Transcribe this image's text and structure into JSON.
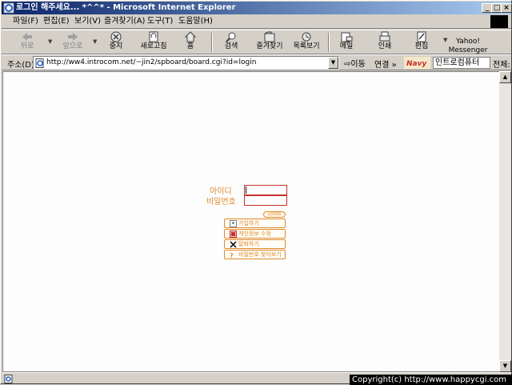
{
  "window": {
    "title": "로그인 해주세요... *^^* - Microsoft Internet Explorer",
    "minimize": "_",
    "maximize": "□",
    "close": "×"
  },
  "menu": [
    "파일(F)",
    "편집(E)",
    "보기(V)",
    "즐겨찾기(A)",
    "도구(T)",
    "도움말(H)"
  ],
  "toolbar": {
    "back": "뒤로",
    "forward": "앞으로",
    "stop": "중지",
    "refresh": "새로고침",
    "home": "홈",
    "search": "검색",
    "favorites": "즐겨찾기",
    "history": "목록보기",
    "mail": "메일",
    "print": "인쇄",
    "edit": "편집",
    "messenger_line1": "Yahoo!",
    "messenger_line2": "Messenger"
  },
  "address": {
    "label": "주소(D)",
    "url": "http://ww4.introcom.net/~jin2/spboard/board.cgi?id=login",
    "go": "⇨이동",
    "links": "연결 »",
    "search_logo": "Navy",
    "search_value": "인트로컴퓨터",
    "search_scope": "전체:"
  },
  "login": {
    "id_label": "아이디",
    "password_label": "비밀번호",
    "login_button": "LOGIN",
    "menu_buttons": [
      "가입하기",
      "개인정보 수정",
      "탈퇴하기",
      "비밀번호 찾아보기"
    ]
  },
  "statusbar": {
    "copyright": "Copyright(c) http://www.happycgi.com"
  },
  "colors": {
    "accent": "#e08a28",
    "input_border": "#c4302b",
    "titlebar": "#0a246a"
  },
  "icons": [
    "ie-page-icon",
    "back-arrow-icon",
    "forward-arrow-icon",
    "stop-icon",
    "refresh-icon",
    "home-icon",
    "search-icon",
    "favorites-icon",
    "history-icon",
    "mail-icon",
    "print-icon",
    "edit-icon"
  ]
}
